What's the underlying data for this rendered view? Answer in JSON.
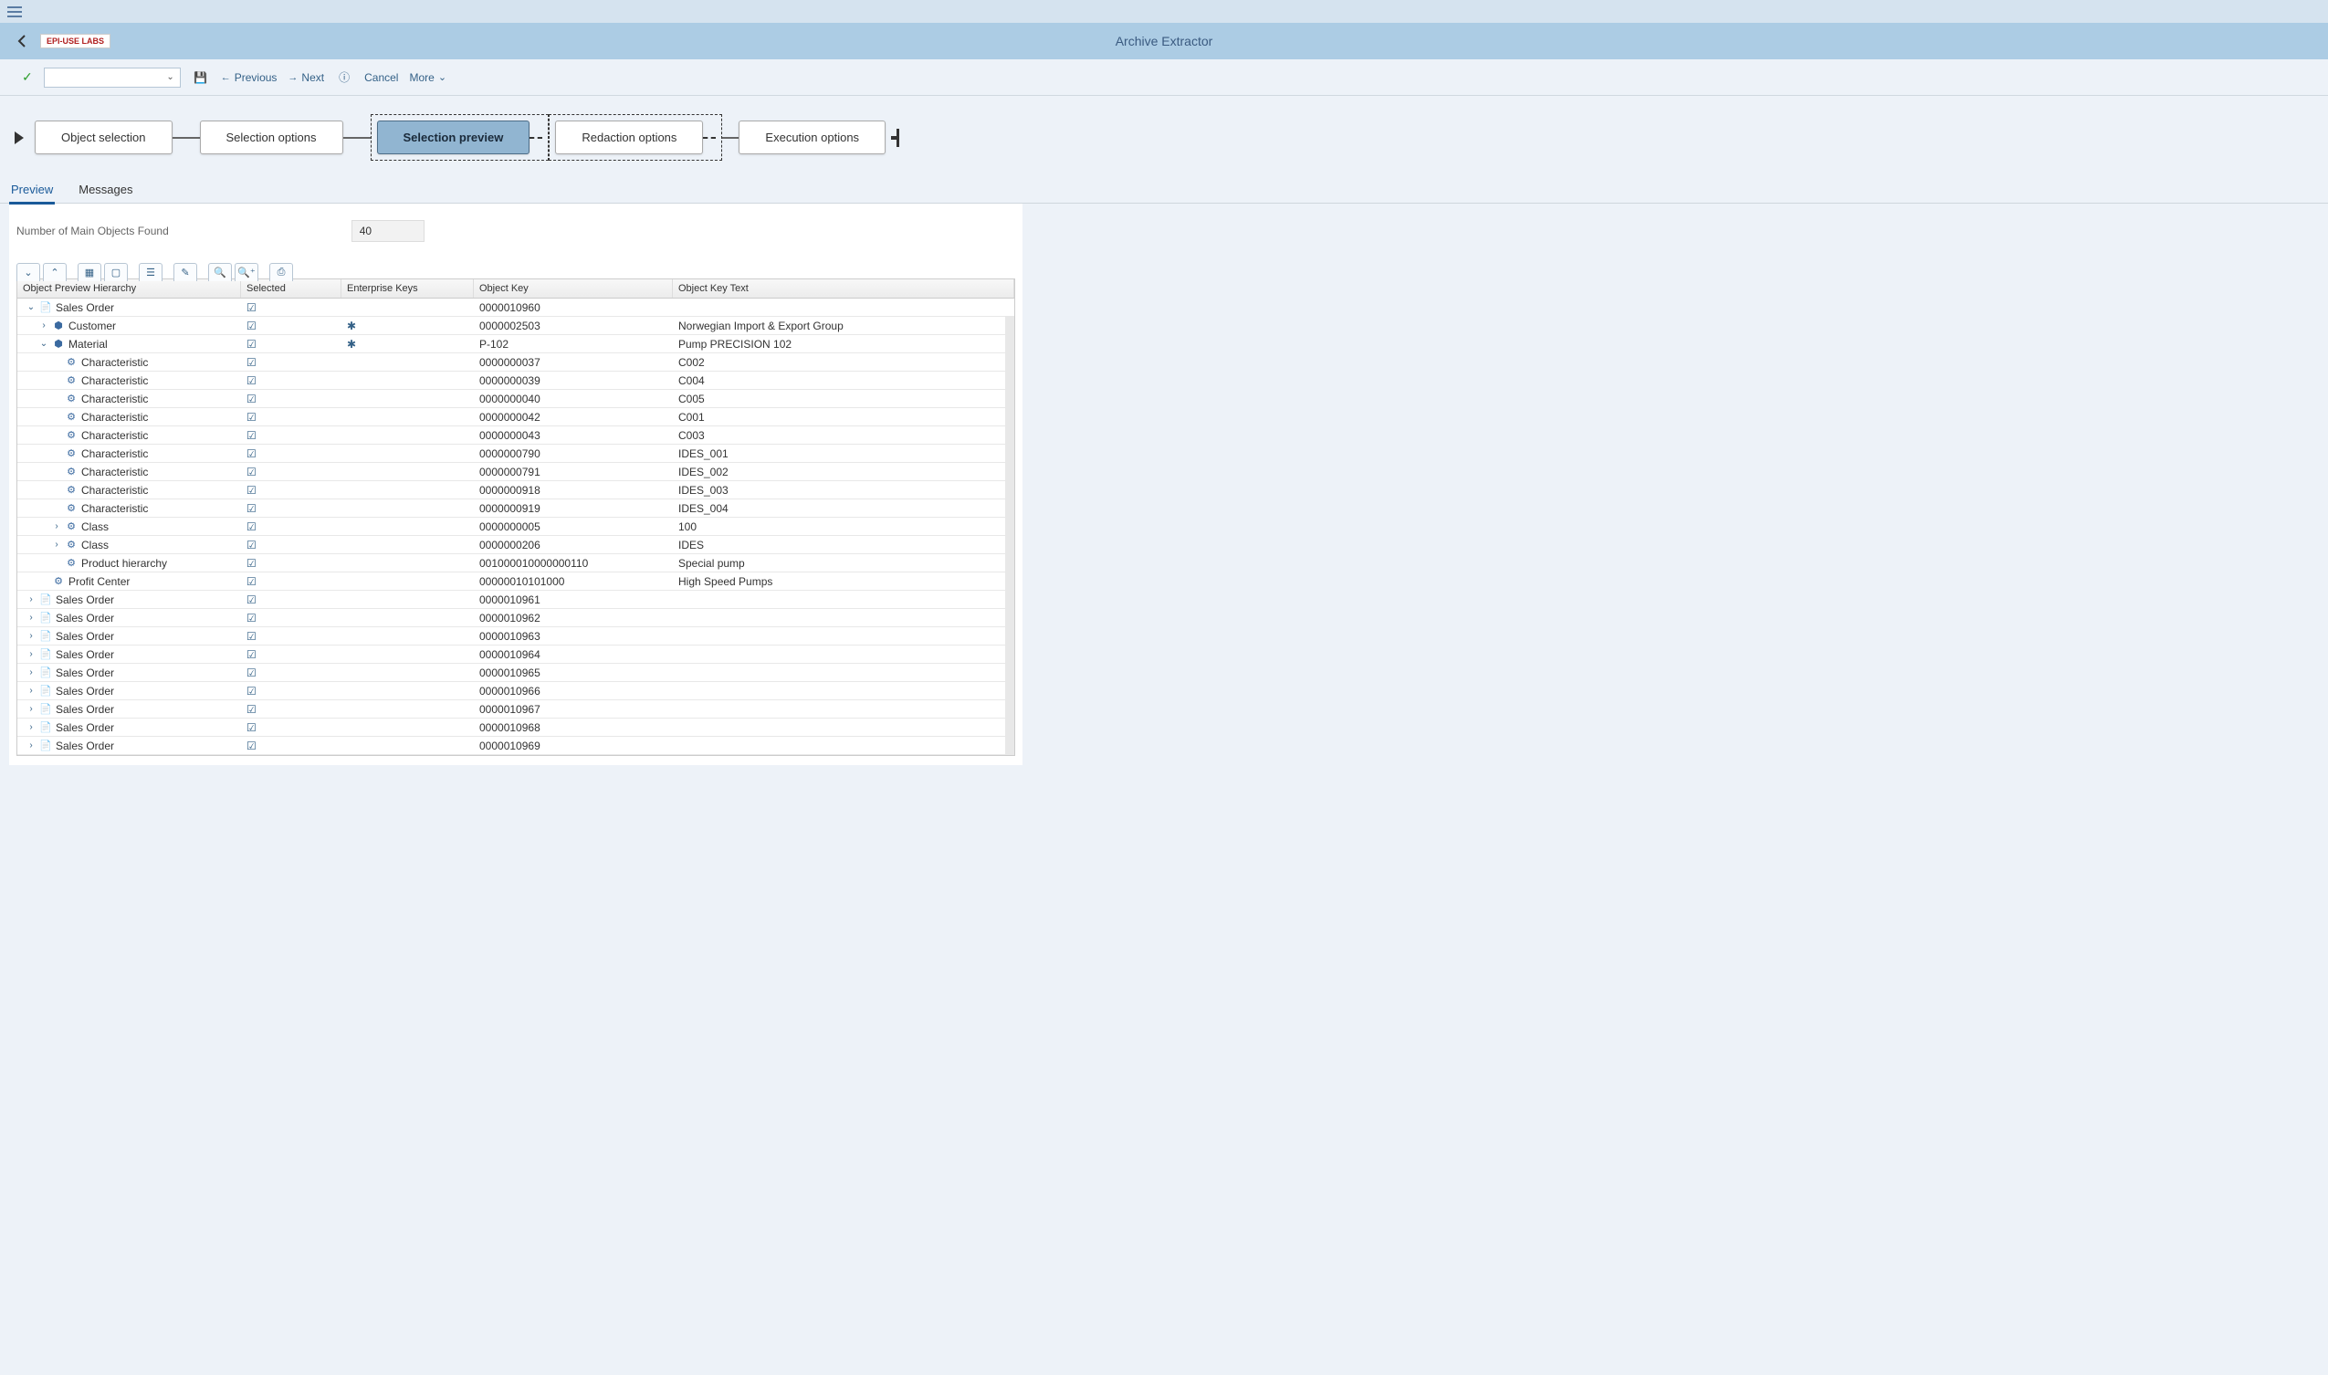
{
  "app": {
    "title": "Archive Extractor",
    "logo": "EPI-USE LABS"
  },
  "toolbar": {
    "previous": "Previous",
    "next": "Next",
    "cancel": "Cancel",
    "more": "More"
  },
  "roadmap": {
    "steps": [
      "Object selection",
      "Selection options",
      "Selection preview",
      "Redaction options",
      "Execution options"
    ]
  },
  "tabs": {
    "preview": "Preview",
    "messages": "Messages"
  },
  "fields": {
    "count_label": "Number of Main Objects Found",
    "count_value": "40"
  },
  "grid": {
    "headers": {
      "hierarchy": "Object Preview Hierarchy",
      "selected": "Selected",
      "enterprise_keys": "Enterprise Keys",
      "object_key": "Object Key",
      "object_key_text": "Object Key Text"
    },
    "rows": [
      {
        "indent": 0,
        "expand": "down",
        "icon": "doc",
        "label": "Sales Order",
        "selected": true,
        "ek": false,
        "ok": "0000010960",
        "okt": ""
      },
      {
        "indent": 1,
        "expand": "right",
        "icon": "cust",
        "label": "Customer",
        "selected": true,
        "ek": true,
        "ok": "0000002503",
        "okt": "Norwegian Import & Export Group"
      },
      {
        "indent": 1,
        "expand": "down",
        "icon": "cust",
        "label": "Material",
        "selected": true,
        "ek": true,
        "ok": "P-102",
        "okt": "Pump PRECISION 102"
      },
      {
        "indent": 2,
        "expand": "none",
        "icon": "cog",
        "label": "Characteristic",
        "selected": true,
        "ek": false,
        "ok": "0000000037",
        "okt": "C002"
      },
      {
        "indent": 2,
        "expand": "none",
        "icon": "cog",
        "label": "Characteristic",
        "selected": true,
        "ek": false,
        "ok": "0000000039",
        "okt": "C004"
      },
      {
        "indent": 2,
        "expand": "none",
        "icon": "cog",
        "label": "Characteristic",
        "selected": true,
        "ek": false,
        "ok": "0000000040",
        "okt": "C005"
      },
      {
        "indent": 2,
        "expand": "none",
        "icon": "cog",
        "label": "Characteristic",
        "selected": true,
        "ek": false,
        "ok": "0000000042",
        "okt": "C001"
      },
      {
        "indent": 2,
        "expand": "none",
        "icon": "cog",
        "label": "Characteristic",
        "selected": true,
        "ek": false,
        "ok": "0000000043",
        "okt": "C003"
      },
      {
        "indent": 2,
        "expand": "none",
        "icon": "cog",
        "label": "Characteristic",
        "selected": true,
        "ek": false,
        "ok": "0000000790",
        "okt": "IDES_001"
      },
      {
        "indent": 2,
        "expand": "none",
        "icon": "cog",
        "label": "Characteristic",
        "selected": true,
        "ek": false,
        "ok": "0000000791",
        "okt": "IDES_002"
      },
      {
        "indent": 2,
        "expand": "none",
        "icon": "cog",
        "label": "Characteristic",
        "selected": true,
        "ek": false,
        "ok": "0000000918",
        "okt": "IDES_003"
      },
      {
        "indent": 2,
        "expand": "none",
        "icon": "cog",
        "label": "Characteristic",
        "selected": true,
        "ek": false,
        "ok": "0000000919",
        "okt": "IDES_004"
      },
      {
        "indent": 2,
        "expand": "right",
        "icon": "cog",
        "label": "Class",
        "selected": true,
        "ek": false,
        "ok": "0000000005",
        "okt": "100"
      },
      {
        "indent": 2,
        "expand": "right",
        "icon": "cog",
        "label": "Class",
        "selected": true,
        "ek": false,
        "ok": "0000000206",
        "okt": "IDES"
      },
      {
        "indent": 2,
        "expand": "none",
        "icon": "cog",
        "label": "Product hierarchy",
        "selected": true,
        "ek": false,
        "ok": "001000010000000110",
        "okt": "Special pump"
      },
      {
        "indent": 1,
        "expand": "none",
        "icon": "cog",
        "label": "Profit Center",
        "selected": true,
        "ek": false,
        "ok": "00000010101000",
        "okt": "High Speed Pumps"
      },
      {
        "indent": 0,
        "expand": "right",
        "icon": "doc",
        "label": "Sales Order",
        "selected": true,
        "ek": false,
        "ok": "0000010961",
        "okt": ""
      },
      {
        "indent": 0,
        "expand": "right",
        "icon": "doc",
        "label": "Sales Order",
        "selected": true,
        "ek": false,
        "ok": "0000010962",
        "okt": ""
      },
      {
        "indent": 0,
        "expand": "right",
        "icon": "doc",
        "label": "Sales Order",
        "selected": true,
        "ek": false,
        "ok": "0000010963",
        "okt": ""
      },
      {
        "indent": 0,
        "expand": "right",
        "icon": "doc",
        "label": "Sales Order",
        "selected": true,
        "ek": false,
        "ok": "0000010964",
        "okt": ""
      },
      {
        "indent": 0,
        "expand": "right",
        "icon": "doc",
        "label": "Sales Order",
        "selected": true,
        "ek": false,
        "ok": "0000010965",
        "okt": ""
      },
      {
        "indent": 0,
        "expand": "right",
        "icon": "doc",
        "label": "Sales Order",
        "selected": true,
        "ek": false,
        "ok": "0000010966",
        "okt": ""
      },
      {
        "indent": 0,
        "expand": "right",
        "icon": "doc",
        "label": "Sales Order",
        "selected": true,
        "ek": false,
        "ok": "0000010967",
        "okt": ""
      },
      {
        "indent": 0,
        "expand": "right",
        "icon": "doc",
        "label": "Sales Order",
        "selected": true,
        "ek": false,
        "ok": "0000010968",
        "okt": ""
      },
      {
        "indent": 0,
        "expand": "right",
        "icon": "doc",
        "label": "Sales Order",
        "selected": true,
        "ek": false,
        "ok": "0000010969",
        "okt": ""
      }
    ]
  }
}
